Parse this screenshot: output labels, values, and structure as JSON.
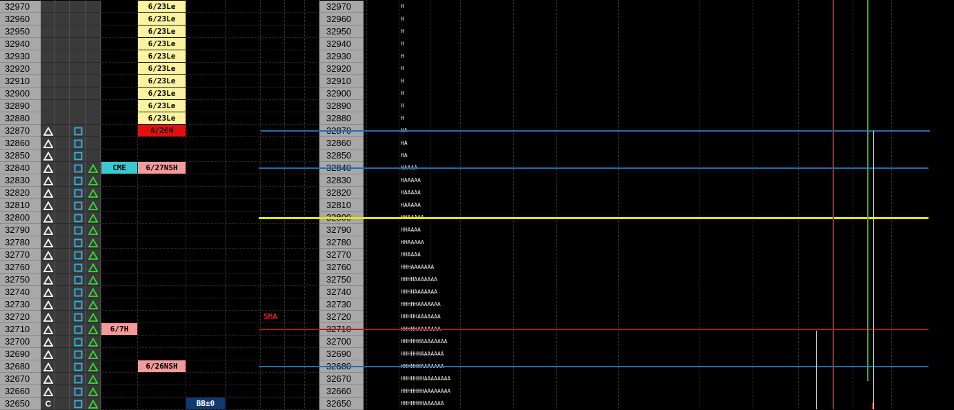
{
  "prices": [
    "32970",
    "32960",
    "32950",
    "32940",
    "32930",
    "32920",
    "32910",
    "32900",
    "32890",
    "32880",
    "32870",
    "32860",
    "32850",
    "32840",
    "32830",
    "32820",
    "32810",
    "32800",
    "32790",
    "32780",
    "32770",
    "32760",
    "32750",
    "32740",
    "32730",
    "32720",
    "32710",
    "32700",
    "32690",
    "32680",
    "32670",
    "32660",
    "32650"
  ],
  "col_a_symbols": [
    "",
    "",
    "",
    "",
    "",
    "",
    "",
    "",
    "",
    "",
    "tri",
    "tri",
    "tri",
    "tri",
    "tri",
    "tri",
    "tri",
    "tri",
    "tri",
    "tri",
    "tri",
    "tri",
    "tri",
    "tri",
    "tri",
    "tri",
    "tri",
    "tri",
    "tri",
    "tri",
    "tri",
    "tri",
    "C"
  ],
  "col_b_symbols": [
    "",
    "",
    "",
    "",
    "",
    "",
    "",
    "",
    "",
    "",
    "sq",
    "sq",
    "sq",
    "sq",
    "sq",
    "sq",
    "sq",
    "sq",
    "sq",
    "sq",
    "sq",
    "sq",
    "sq",
    "sq",
    "sq",
    "sq",
    "sq",
    "sq",
    "sq",
    "sq",
    "sq",
    "sq",
    "sq"
  ],
  "col_c_symbols": [
    "",
    "",
    "",
    "",
    "",
    "",
    "",
    "",
    "",
    "",
    "",
    "",
    "",
    "gtri",
    "gtri",
    "gtri",
    "gtri",
    "gtri",
    "gtri",
    "gtri",
    "gtri",
    "gtri",
    "gtri",
    "gtri",
    "gtri",
    "gtri",
    "gtri",
    "gtri",
    "gtri",
    "gtri",
    "gtri",
    "gtri",
    "gtri"
  ],
  "c_label": "C",
  "tags_col1": [
    {
      "row": 13,
      "text": "CME",
      "style": "cyan"
    },
    {
      "row": 26,
      "text": "6/7H",
      "style": "pink"
    }
  ],
  "tags_col2": [
    {
      "row": 0,
      "text": "6/23Le",
      "style": "yellow"
    },
    {
      "row": 1,
      "text": "6/23Le",
      "style": "yellow"
    },
    {
      "row": 2,
      "text": "6/23Le",
      "style": "yellow"
    },
    {
      "row": 3,
      "text": "6/23Le",
      "style": "yellow"
    },
    {
      "row": 4,
      "text": "6/23Le",
      "style": "yellow"
    },
    {
      "row": 5,
      "text": "6/23Le",
      "style": "yellow"
    },
    {
      "row": 6,
      "text": "6/23Le",
      "style": "yellow"
    },
    {
      "row": 7,
      "text": "6/23Le",
      "style": "yellow"
    },
    {
      "row": 8,
      "text": "6/23Le",
      "style": "yellow"
    },
    {
      "row": 9,
      "text": "6/23Le",
      "style": "yellow"
    },
    {
      "row": 10,
      "text": "6/26H",
      "style": "red"
    },
    {
      "row": 13,
      "text": "6/27NSH",
      "style": "pink"
    },
    {
      "row": 29,
      "text": "6/26NSH",
      "style": "pink"
    }
  ],
  "tags_col3": [
    {
      "row": 32,
      "text": "BB±0",
      "style": "navy"
    }
  ],
  "ma_label": {
    "row": 25,
    "text": "5MA"
  },
  "tpo_strings": [
    "H",
    "H",
    "H",
    "H",
    "H",
    "H",
    "H",
    "H",
    "H",
    "H",
    "HA",
    "HA",
    "HA",
    "HAAAA",
    "HAAAAA",
    "HAAAAA",
    "HAAAAA",
    "HHAAAAA",
    "HHAAAA",
    "HHAAAAA",
    "HHAAAA",
    "HHHAAAAAAA",
    "HHHHAAAAAAA",
    "HHHHAAAAAAA",
    "HHHHHAAAAAAA",
    "HHHHHAAAAAAA",
    "HHHHHAAAAAAA",
    "HHHHHHAAAAAAAA",
    "HHHHHHAAAAAAA",
    "HHHHHHAAAAAAA",
    "HHHHHHHAAAAAAAA",
    "HHHHHHHAAAAAAAA",
    "HHHHHHHAAAAAA"
  ],
  "horizontal_levels": [
    {
      "row": 10,
      "color": "#1e6fb5",
      "name": "level-32870"
    },
    {
      "row": 13,
      "color": "#1e6fb5",
      "name": "level-32840"
    },
    {
      "row": 17,
      "color": "#e6e600",
      "name": "level-32800"
    },
    {
      "row": 26,
      "color": "#b01818",
      "name": "level-32710"
    },
    {
      "row": 29,
      "color": "#1e6fb5",
      "name": "level-32680"
    }
  ],
  "colors": {
    "price_bg": "#a8a8a8",
    "yellow_tag": "#fbf3a0",
    "red_tag": "#e01010",
    "pink_tag": "#f49a9a",
    "cyan_tag": "#3ac9cf",
    "navy_tag": "#123a6e",
    "ma_red": "#d82020",
    "green_line": "#20c020",
    "red_line": "#c02020"
  }
}
